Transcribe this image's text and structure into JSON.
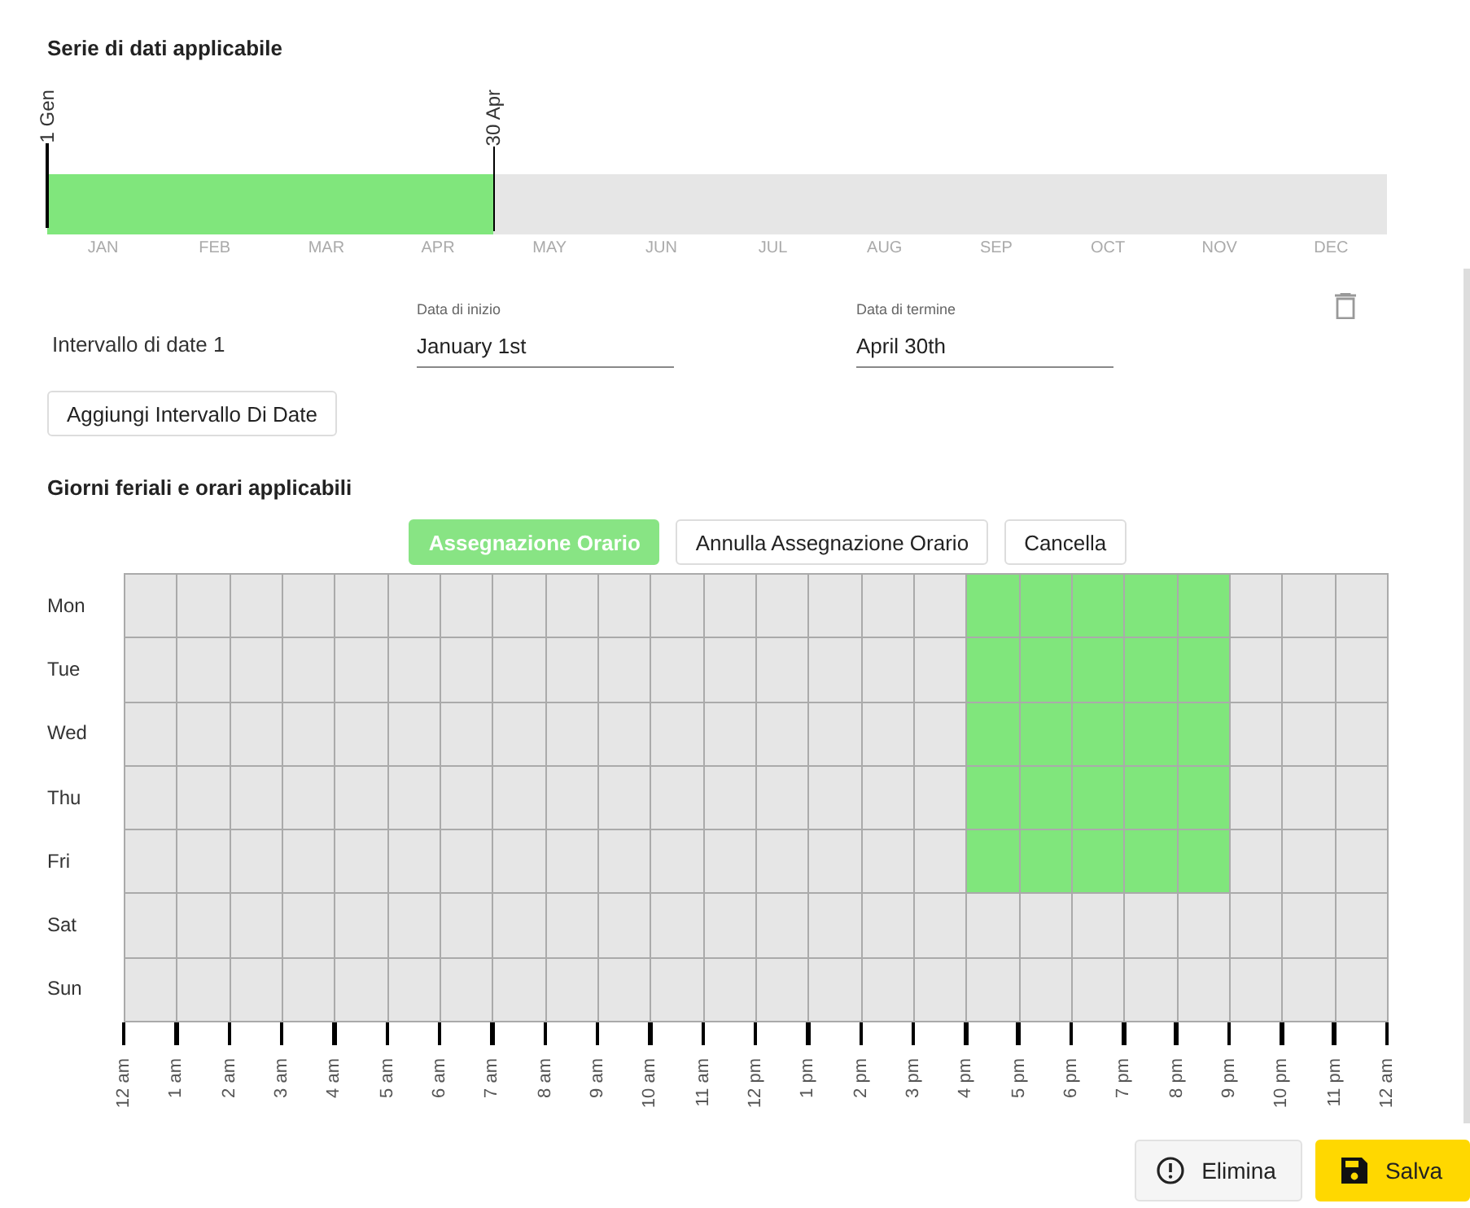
{
  "date_section": {
    "title": "Serie di dati applicabile"
  },
  "timeline": {
    "start_marker": "1 Gen",
    "end_marker": "30 Apr",
    "months": [
      {
        "label": "JAN",
        "selected": true
      },
      {
        "label": "FEB",
        "selected": true
      },
      {
        "label": "MAR",
        "selected": true
      },
      {
        "label": "APR",
        "selected": true
      },
      {
        "label": "MAY",
        "selected": false
      },
      {
        "label": "JUN",
        "selected": false
      },
      {
        "label": "JUL",
        "selected": false
      },
      {
        "label": "AUG",
        "selected": false
      },
      {
        "label": "SEP",
        "selected": false
      },
      {
        "label": "OCT",
        "selected": false
      },
      {
        "label": "NOV",
        "selected": false
      },
      {
        "label": "DEC",
        "selected": false
      }
    ]
  },
  "date_ranges": [
    {
      "label": "Intervallo di date 1",
      "start": {
        "label": "Data di inizio",
        "value": "January 1st"
      },
      "end": {
        "label": "Data di termine",
        "value": "April 30th"
      }
    }
  ],
  "add_range_button": "Aggiungi Intervallo Di Date",
  "schedule_section": {
    "title": "Giorni feriali e orari applicabili"
  },
  "schedule_buttons": [
    {
      "label": "Assegnazione Orario",
      "selected": true
    },
    {
      "label": "Annulla Assegnazione Orario",
      "selected": false
    },
    {
      "label": "Cancella",
      "selected": false
    }
  ],
  "schedule": [
    {
      "day": "Mon",
      "slots": [
        false,
        false,
        false,
        false,
        false,
        false,
        false,
        false,
        false,
        false,
        false,
        false,
        false,
        false,
        false,
        false,
        true,
        true,
        true,
        true,
        true,
        false,
        false,
        false
      ]
    },
    {
      "day": "Tue",
      "slots": [
        false,
        false,
        false,
        false,
        false,
        false,
        false,
        false,
        false,
        false,
        false,
        false,
        false,
        false,
        false,
        false,
        true,
        true,
        true,
        true,
        true,
        false,
        false,
        false
      ]
    },
    {
      "day": "Wed",
      "slots": [
        false,
        false,
        false,
        false,
        false,
        false,
        false,
        false,
        false,
        false,
        false,
        false,
        false,
        false,
        false,
        false,
        true,
        true,
        true,
        true,
        true,
        false,
        false,
        false
      ]
    },
    {
      "day": "Thu",
      "slots": [
        false,
        false,
        false,
        false,
        false,
        false,
        false,
        false,
        false,
        false,
        false,
        false,
        false,
        false,
        false,
        false,
        true,
        true,
        true,
        true,
        true,
        false,
        false,
        false
      ]
    },
    {
      "day": "Fri",
      "slots": [
        false,
        false,
        false,
        false,
        false,
        false,
        false,
        false,
        false,
        false,
        false,
        false,
        false,
        false,
        false,
        false,
        true,
        true,
        true,
        true,
        true,
        false,
        false,
        false
      ]
    },
    {
      "day": "Sat",
      "slots": [
        false,
        false,
        false,
        false,
        false,
        false,
        false,
        false,
        false,
        false,
        false,
        false,
        false,
        false,
        false,
        false,
        false,
        false,
        false,
        false,
        false,
        false,
        false,
        false
      ]
    },
    {
      "day": "Sun",
      "slots": [
        false,
        false,
        false,
        false,
        false,
        false,
        false,
        false,
        false,
        false,
        false,
        false,
        false,
        false,
        false,
        false,
        false,
        false,
        false,
        false,
        false,
        false,
        false,
        false
      ]
    }
  ],
  "hour_labels": [
    "12 am",
    "1 am",
    "2 am",
    "3 am",
    "4 am",
    "5 am",
    "6 am",
    "7 am",
    "8 am",
    "9 am",
    "10 am",
    "11 am",
    "12 pm",
    "1 pm",
    "2 pm",
    "3 pm",
    "4 pm",
    "5 pm",
    "6 pm",
    "7 pm",
    "8 pm",
    "9 pm",
    "10 pm",
    "11 pm",
    "12 am"
  ],
  "footer_buttons": [
    {
      "kind": "delete",
      "label": "Elimina"
    },
    {
      "kind": "save",
      "label": "Salva"
    }
  ]
}
